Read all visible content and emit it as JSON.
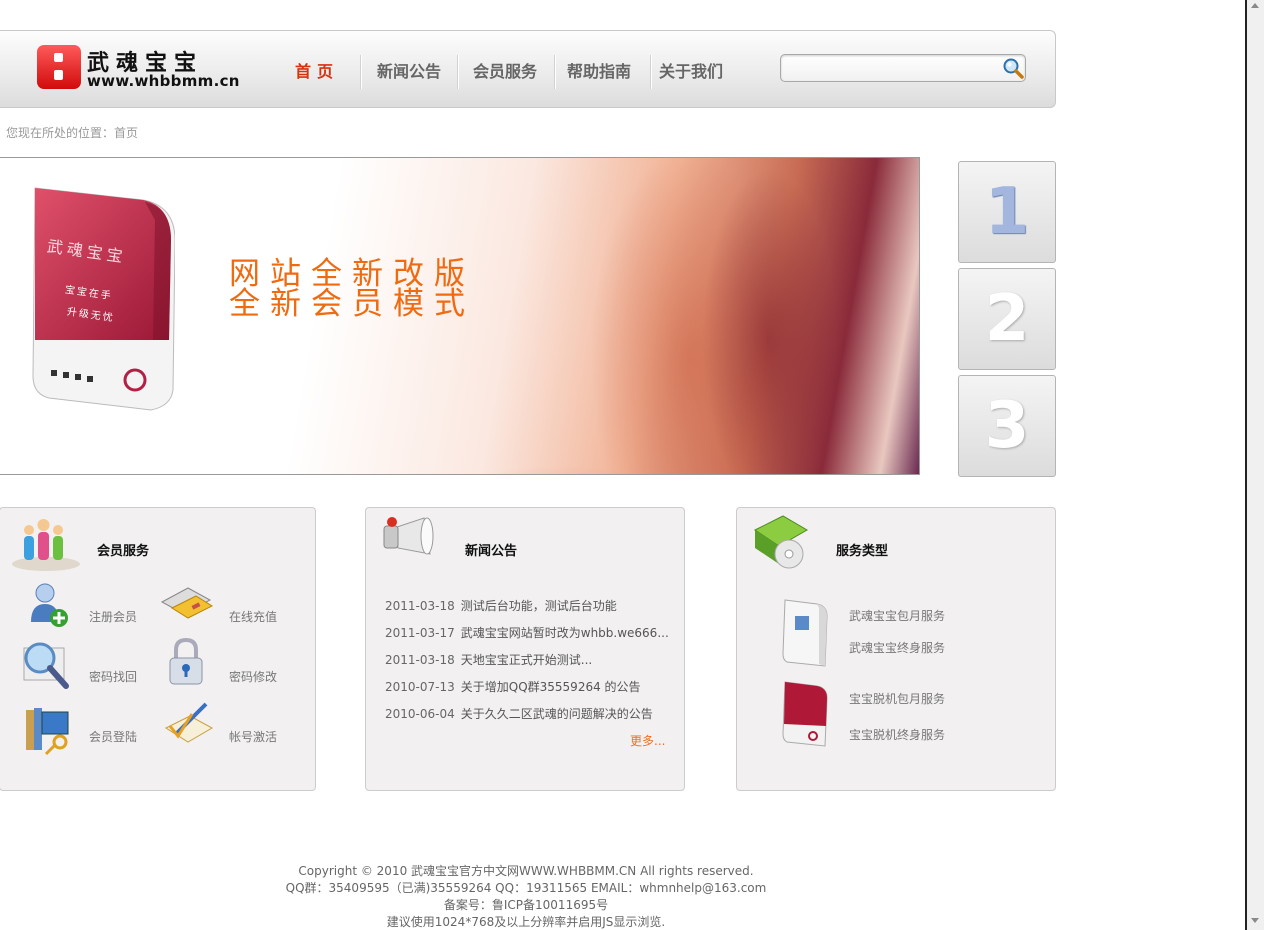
{
  "header": {
    "logo_name": "武魂宝宝",
    "logo_url": "www.whbbmm.cn",
    "nav": [
      {
        "label": "首页"
      },
      {
        "label": "新闻公告"
      },
      {
        "label": "会员服务"
      },
      {
        "label": "帮助指南"
      },
      {
        "label": "关于我们"
      }
    ],
    "search": {
      "value": "",
      "placeholder": ""
    }
  },
  "breadcrumb": "您现在所处的位置：首页",
  "banner": {
    "box_text": [
      "武魂宝宝",
      "宝宝在手",
      "升级无忧"
    ],
    "line1": "网站全新改版",
    "line2": "全新会员模式",
    "slides": [
      "1",
      "2",
      "3"
    ],
    "active_slide": 1
  },
  "member_panel": {
    "title": "会员服务",
    "items": [
      {
        "label": "注册会员",
        "icon": "add-user-icon"
      },
      {
        "label": "在线充值",
        "icon": "credit-card-icon"
      },
      {
        "label": "密码找回",
        "icon": "magnifier-icon"
      },
      {
        "label": "密码修改",
        "icon": "lock-icon"
      },
      {
        "label": "会员登陆",
        "icon": "login-books-icon"
      },
      {
        "label": "帐号激活",
        "icon": "pencil-activate-icon"
      }
    ]
  },
  "news_panel": {
    "title": "新闻公告",
    "items": [
      {
        "date": "2011-03-18",
        "title": "测试后台功能，测试后台功能"
      },
      {
        "date": "2011-03-17",
        "title": "武魂宝宝网站暂时改为whbb.we666..."
      },
      {
        "date": "2011-03-18",
        "title": "天地宝宝正式开始测试..."
      },
      {
        "date": "2010-07-13",
        "title": "关于增加QQ群35559264 的公告"
      },
      {
        "date": "2010-06-04",
        "title": "关于久久二区武魂的问题解决的公告"
      }
    ],
    "more": "更多..."
  },
  "service_panel": {
    "title": "服务类型",
    "items": [
      {
        "label": "武魂宝宝包月服务"
      },
      {
        "label": "武魂宝宝终身服务"
      },
      {
        "label": "宝宝脱机包月服务"
      },
      {
        "label": "宝宝脱机终身服务"
      }
    ]
  },
  "footer": {
    "line1": "Copyright © 2010 武魂宝宝官方中文网WWW.WHBBMM.CN All rights reserved.",
    "line2": "QQ群：35409595（已满)35559264 QQ：19311565 EMAIL：whmnhelp@163.com",
    "line3": "备案号：鲁ICP备10011695号",
    "line4": "建议使用1024*768及以上分辨率并启用JS显示浏览."
  },
  "colors": {
    "accent": "#f06a10",
    "nav_active": "#d83010",
    "logo_red": "#e01818"
  }
}
